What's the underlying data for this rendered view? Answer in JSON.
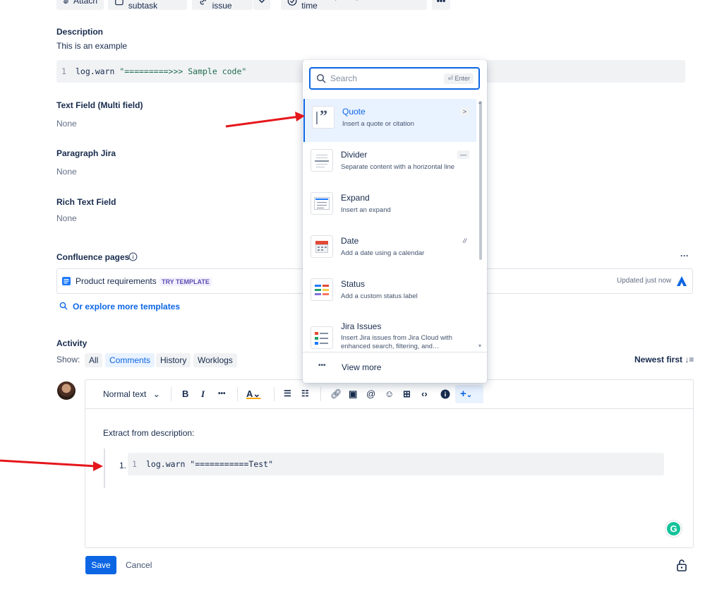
{
  "toolbar": {
    "attach": "Attach",
    "create_subtask": "Create subtask",
    "link_issue": "Link issue",
    "tempo": "Add Tempo to plan and track time"
  },
  "description": {
    "label": "Description",
    "text": "This is an example",
    "code_line_no": "1",
    "code_keyword": "log.warn ",
    "code_string": "\"=========>>> Sample code\""
  },
  "fields": {
    "text_field_label": "Text Field (Multi field)",
    "text_field_value": "None",
    "paragraph_label": "Paragraph Jira",
    "paragraph_value": "None",
    "rich_text_label": "Rich Text Field",
    "rich_text_value": "None"
  },
  "confluence": {
    "label": "Confluence pages",
    "page_title": "Product requirements",
    "try_badge": "TRY TEMPLATE",
    "updated": "Updated just now",
    "explore": "Or explore more templates",
    "more": "···"
  },
  "activity": {
    "label": "Activity",
    "show": "Show:",
    "tabs": [
      "All",
      "Comments",
      "History",
      "Worklogs"
    ],
    "sort": "Newest first"
  },
  "editor": {
    "text_style": "Normal text",
    "body_text": "Extract from description:",
    "list_number": "1.",
    "code_line_no": "1",
    "code": "log.warn \"===========Test\""
  },
  "menu": {
    "search_placeholder": "Search",
    "enter_hint": "⏎ Enter",
    "items": [
      {
        "title": "Quote",
        "desc": "Insert a quote or citation",
        "shortcut": ">"
      },
      {
        "title": "Divider",
        "desc": "Separate content with a horizontal line",
        "shortcut": "—"
      },
      {
        "title": "Expand",
        "desc": "Insert an expand",
        "shortcut": ""
      },
      {
        "title": "Date",
        "desc": "Add a date using a calendar",
        "shortcut": "//"
      },
      {
        "title": "Status",
        "desc": "Add a custom status label",
        "shortcut": ""
      },
      {
        "title": "Jira Issues",
        "desc": "Insert Jira issues from Jira Cloud with enhanced search, filtering, and…",
        "shortcut": ""
      }
    ],
    "view_more": "View more"
  },
  "actions": {
    "save": "Save",
    "cancel": "Cancel"
  },
  "colors": {
    "accent": "#0c66e4",
    "arrow": "#e5171c",
    "selected_bg": "#e9f2ff"
  }
}
